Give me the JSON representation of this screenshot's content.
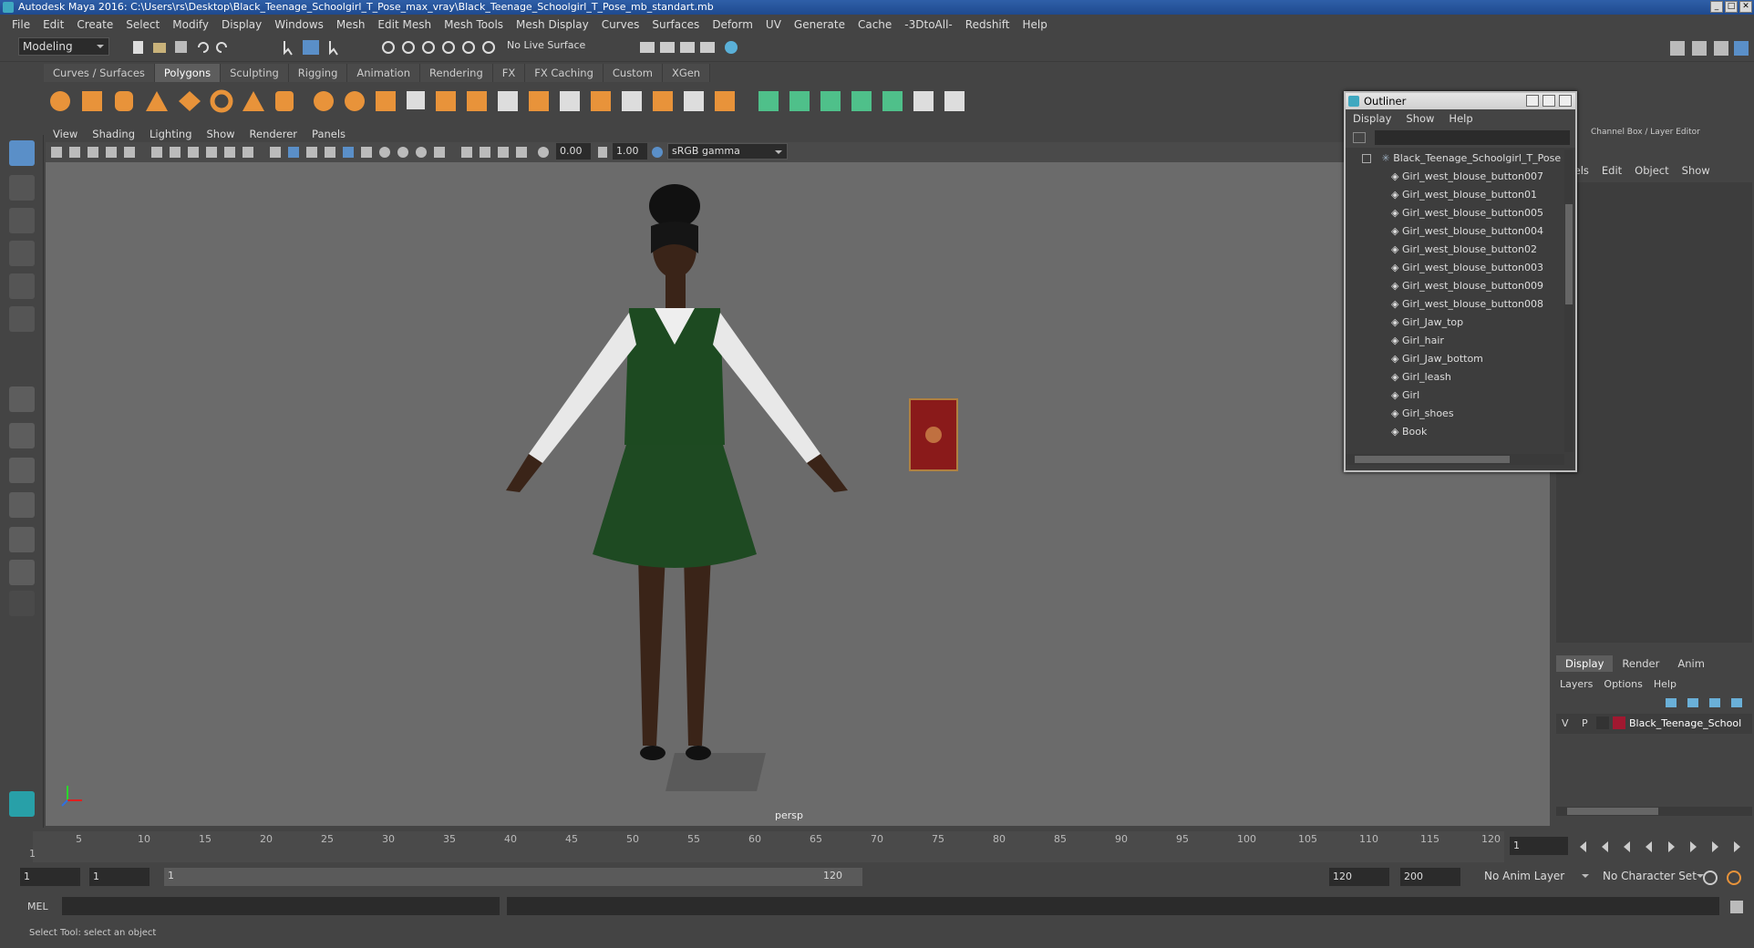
{
  "window": {
    "title": "Autodesk Maya 2016: C:\\Users\\rs\\Desktop\\Black_Teenage_Schoolgirl_T_Pose_max_vray\\Black_Teenage_Schoolgirl_T_Pose_mb_standart.mb",
    "controls": [
      "_",
      "□",
      "✕"
    ]
  },
  "menubar": [
    "File",
    "Edit",
    "Create",
    "Select",
    "Modify",
    "Display",
    "Windows",
    "Mesh",
    "Edit Mesh",
    "Mesh Tools",
    "Mesh Display",
    "Curves",
    "Surfaces",
    "Deform",
    "UV",
    "Generate",
    "Cache",
    "-3DtoAll-",
    "Redshift",
    "Help"
  ],
  "status": {
    "mode": "Modeling",
    "live_surface": "No Live Surface"
  },
  "shelf_tabs": [
    "Curves / Surfaces",
    "Polygons",
    "Sculpting",
    "Rigging",
    "Animation",
    "Rendering",
    "FX",
    "FX Caching",
    "Custom",
    "XGen"
  ],
  "active_shelf": "Polygons",
  "viewport": {
    "menu": [
      "View",
      "Shading",
      "Lighting",
      "Show",
      "Renderer",
      "Panels"
    ],
    "exposure": "0.00",
    "gamma": "1.00",
    "colorspace": "sRGB gamma",
    "camera": "persp"
  },
  "outliner": {
    "title": "Outliner",
    "menu": [
      "Display",
      "Show",
      "Help"
    ],
    "root": "Black_Teenage_Schoolgirl_T_Pose",
    "items": [
      "Girl_west_blouse_button007",
      "Girl_west_blouse_button01",
      "Girl_west_blouse_button005",
      "Girl_west_blouse_button004",
      "Girl_west_blouse_button02",
      "Girl_west_blouse_button003",
      "Girl_west_blouse_button009",
      "Girl_west_blouse_button008",
      "Girl_Jaw_top",
      "Girl_hair",
      "Girl_Jaw_bottom",
      "Girl_leash",
      "Girl",
      "Girl_shoes",
      "Book"
    ]
  },
  "channel_box": {
    "title": "Channel Box / Layer Editor",
    "menu": [
      "annels",
      "Edit",
      "Object",
      "Show"
    ]
  },
  "layer_editor": {
    "tabs": [
      "Display",
      "Render",
      "Anim"
    ],
    "menu": [
      "Layers",
      "Options",
      "Help"
    ],
    "layer": {
      "v": "V",
      "p": "P",
      "name": "Black_Teenage_School",
      "color": "#a01830"
    }
  },
  "timeline": {
    "ticks": [
      "1",
      "5",
      "10",
      "15",
      "20",
      "25",
      "30",
      "35",
      "40",
      "45",
      "50",
      "55",
      "60",
      "65",
      "70",
      "75",
      "80",
      "85",
      "90",
      "95",
      "100",
      "105",
      "110",
      "115",
      "120"
    ],
    "current_frame": "1"
  },
  "range": {
    "start": "1",
    "start2": "1",
    "slider_start": "1",
    "slider_end": "120",
    "end": "120",
    "end2": "200",
    "anim_layer": "No Anim Layer",
    "char_set": "No Character Set"
  },
  "cmdline": {
    "label": "MEL"
  },
  "helpline": {
    "text": "Select Tool: select an object"
  }
}
